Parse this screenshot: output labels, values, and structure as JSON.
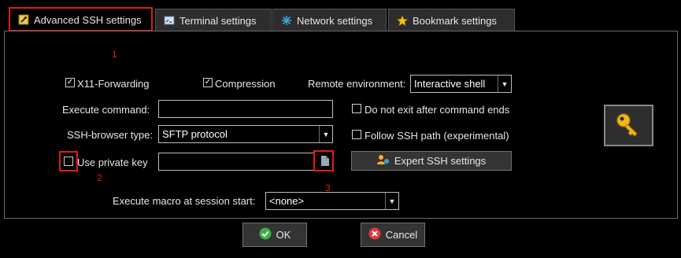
{
  "tabs": [
    {
      "label": "Advanced SSH settings",
      "icon": "wrench-icon"
    },
    {
      "label": "Terminal settings",
      "icon": "terminal-icon"
    },
    {
      "label": "Network settings",
      "icon": "network-icon"
    },
    {
      "label": "Bookmark settings",
      "icon": "star-icon"
    }
  ],
  "options": {
    "x11_label": "X11-Forwarding",
    "x11_checked": true,
    "compression_label": "Compression",
    "compression_checked": true,
    "remote_env_label": "Remote environment:",
    "remote_env_value": "Interactive shell",
    "execute_command_label": "Execute command:",
    "execute_command_value": "",
    "no_exit_label": "Do not exit after command ends",
    "no_exit_checked": false,
    "browser_type_label": "SSH-browser type:",
    "browser_type_value": "SFTP protocol",
    "follow_path_label": "Follow SSH path (experimental)",
    "follow_path_checked": false,
    "private_key_label": "Use private key",
    "private_key_checked": false,
    "private_key_value": "",
    "expert_label": "Expert SSH settings",
    "macro_label": "Execute macro at session start:",
    "macro_value": "<none>"
  },
  "annotations": {
    "n1": "1",
    "n2": "2",
    "n3": "3"
  },
  "footer": {
    "ok_label": "OK",
    "cancel_label": "Cancel"
  },
  "colors": {
    "accent": "#e01b1b",
    "ok": "#3cb043",
    "cancel": "#e0393e",
    "key": "#f2b51d"
  }
}
